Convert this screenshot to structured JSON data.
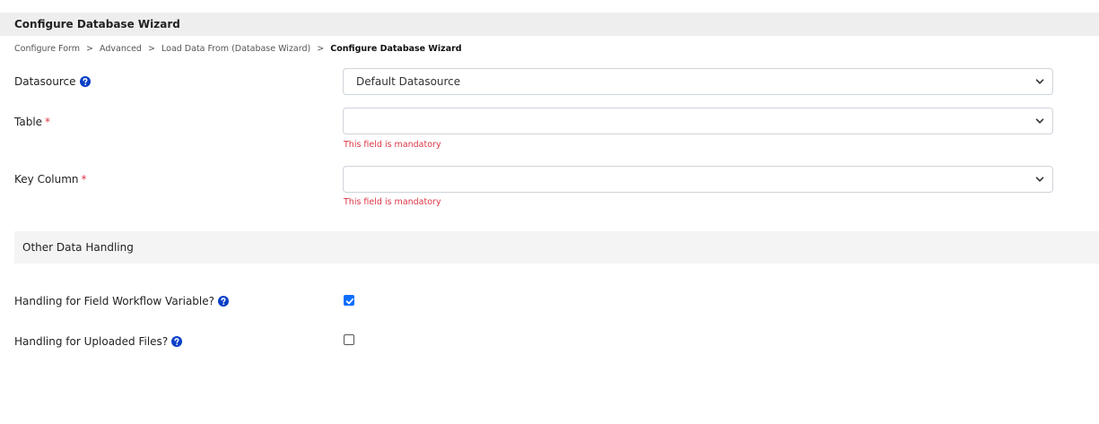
{
  "header": {
    "title": "Configure Database Wizard"
  },
  "breadcrumb": {
    "items": [
      "Configure Form",
      "Advanced",
      "Load Data From (Database Wizard)"
    ],
    "separator": ">",
    "current": "Configure Database Wizard"
  },
  "form": {
    "datasource": {
      "label": "Datasource",
      "value": "Default Datasource"
    },
    "table": {
      "label": "Table",
      "required_mark": "*",
      "value": "",
      "error": "This field is mandatory"
    },
    "key_column": {
      "label": "Key Column",
      "required_mark": "*",
      "value": "",
      "error": "This field is mandatory"
    }
  },
  "other_data_handling": {
    "title": "Other Data Handling",
    "workflow_variable": {
      "label": "Handling for Field Workflow Variable?",
      "checked": true
    },
    "uploaded_files": {
      "label": "Handling for Uploaded Files?",
      "checked": false
    }
  },
  "icons": {
    "help": "question-circle-icon",
    "dropdown": "chevron-down-icon",
    "check": "check-icon"
  },
  "colors": {
    "accent": "#0d6efd",
    "help_icon": "#0a3fc7",
    "error": "#dc3545",
    "title_bar_bg": "#eeeeee",
    "section_bg": "#f4f4f4"
  }
}
